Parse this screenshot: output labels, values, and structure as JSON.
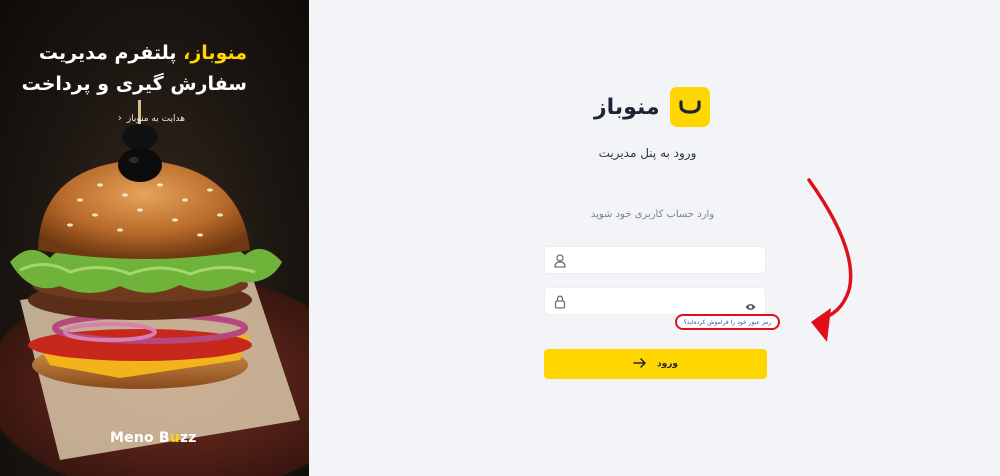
{
  "hero": {
    "title_brand": "منوباز،",
    "title_line1_rest": "پلتفرم مدیریت",
    "title_line2": "سفارش گیری و پرداخت",
    "link_label": "هدایت به منوباز",
    "logo_part1": "Meno B",
    "logo_part2": "u",
    "logo_part3": "zz"
  },
  "brand": {
    "name": "منوباز",
    "accent_color": "#ffd600"
  },
  "login": {
    "panel_title": "ورود به پنل مدیریت",
    "subtitle": "وارد حساب کاربری خود شوید",
    "username_value": "",
    "password_value": "",
    "forgot_label": "رمز عبور خود را فراموش کرده‌اید؟",
    "submit_label": "ورود"
  },
  "icons": {
    "user": "user-icon",
    "lock": "lock-icon",
    "eye": "eye-icon",
    "arrow": "arrow-right-icon",
    "chevron": "chevron-left-icon"
  },
  "annotation": {
    "color": "#e0101a"
  }
}
